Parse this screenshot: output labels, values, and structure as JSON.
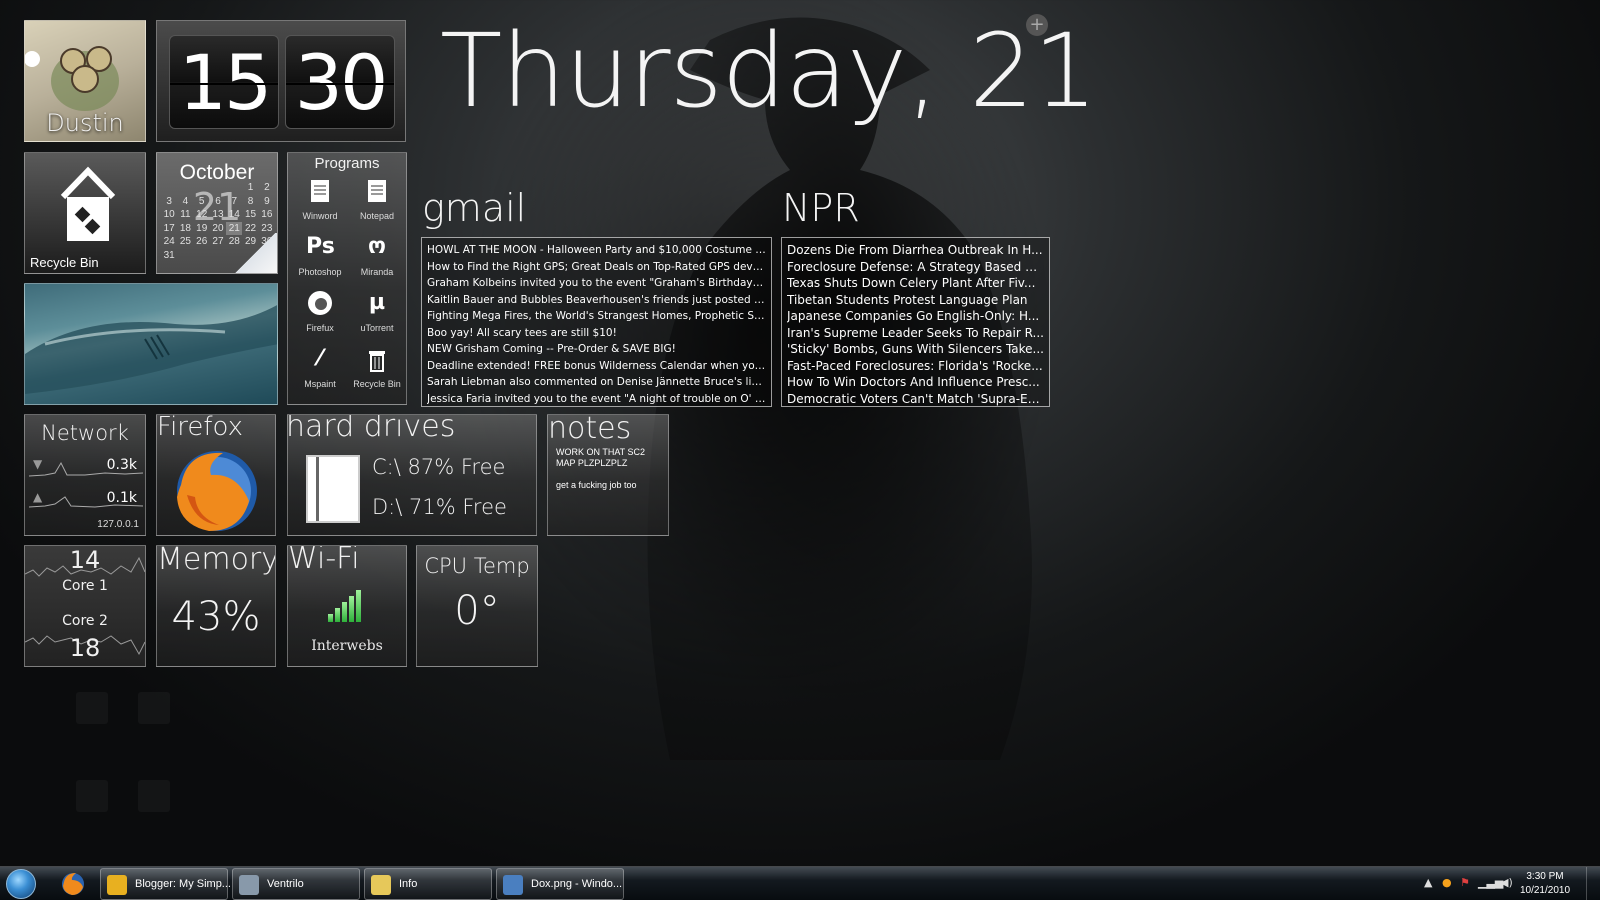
{
  "user": {
    "name": "Dustin"
  },
  "clock": {
    "hour": "15",
    "minute": "30"
  },
  "date_heading": "Thursday, 21",
  "recycle_bin": {
    "label": "Recycle Bin"
  },
  "calendar": {
    "month": "October",
    "day": "21",
    "weekday_row": [
      "S",
      "M",
      "T",
      "W",
      "T",
      "F",
      "S"
    ],
    "days": [
      "",
      "",
      "",
      "",
      "",
      "1",
      "2",
      "3",
      "4",
      "5",
      "6",
      "7",
      "8",
      "9",
      "10",
      "11",
      "12",
      "13",
      "14",
      "15",
      "16",
      "17",
      "18",
      "19",
      "20",
      "21",
      "22",
      "23",
      "24",
      "25",
      "26",
      "27",
      "28",
      "29",
      "30",
      "31"
    ]
  },
  "programs": {
    "title": "Programs",
    "items": [
      {
        "label": "Winword",
        "icon": "word-icon"
      },
      {
        "label": "Notepad",
        "icon": "notepad-icon"
      },
      {
        "label": "Photoshop",
        "icon": "photoshop-icon",
        "glyph": "Ps"
      },
      {
        "label": "Miranda",
        "icon": "miranda-icon",
        "glyph": "ო"
      },
      {
        "label": "Firefux",
        "icon": "firefox-icon"
      },
      {
        "label": "uTorrent",
        "icon": "utorrent-icon",
        "glyph": "µ"
      },
      {
        "label": "Mspaint",
        "icon": "mspaint-icon",
        "glyph": "⁄"
      },
      {
        "label": "Recycle Bin",
        "icon": "trash-icon"
      }
    ]
  },
  "gmail": {
    "title": "gmail",
    "items": [
      "HOWL AT THE MOON - Halloween Party and $10,000 Costume Con...",
      "How to Find the Right GPS; Great Deals on Top-Rated GPS device...",
      "Graham Kolbeins invited you to the event \"Graham's Birthday Pic...",
      "Kaitlin Bauer and Bubbles Beaverhousen's friends just posted in F...",
      "Fighting Mega Fires, the World's Strangest Homes, Prophetic Sci-F...",
      "Boo yay! All scary tees are still $10!",
      "NEW Grisham Coming -- Pre-Order & SAVE BIG!",
      "Deadline extended! FREE bonus Wilderness Calendar when you be...",
      "Sarah Liebman also commented on Denise Jännette Bruce's link.",
      "Jessica Faria invited you to the event \"A night of trouble on O' H..."
    ]
  },
  "npr": {
    "title": "NPR",
    "items": [
      "Dozens Die From Diarrhea Outbreak In H...",
      "Foreclosure Defense: A Strategy Based O...",
      "Texas Shuts Down Celery Plant After Fiv...",
      "Tibetan Students Protest Language Plan",
      "Japanese Companies Go English-Only: H...",
      "Iran's Supreme Leader Seeks To Repair R...",
      "'Sticky' Bombs, Guns With Silencers Take...",
      "Fast-Paced Foreclosures: Florida's 'Rocke...",
      "How To Win Doctors And Influence Presc...",
      "Democratic Voters Can't Match 'Supra-En..."
    ]
  },
  "network": {
    "title": "Network",
    "down": "0.3k",
    "up": "0.1k",
    "ip": "127.0.0.1"
  },
  "firefox_tile": {
    "title": "Firefox"
  },
  "hard_drives": {
    "title": "hard drives",
    "c": "C:\\ 87% Free",
    "d": "D:\\ 71% Free"
  },
  "notes": {
    "title": "notes",
    "line1": "WORK ON THAT SC2",
    "line2": "MAP PLZPLZPLZ",
    "line3": "get a fucking job too"
  },
  "cores": {
    "core1_value": "14",
    "core1_label": "Core 1",
    "core2_label": "Core 2",
    "core2_value": "18"
  },
  "memory": {
    "title": "Memory",
    "value": "43%"
  },
  "wifi": {
    "title": "Wi-Fi",
    "subtitle": "Interwebs",
    "signal_bars": 5
  },
  "cpu_temp": {
    "title": "CPU Temp",
    "value": "0°"
  },
  "taskbar": {
    "buttons": [
      {
        "label": "Blogger: My Simp...",
        "icon": "chrome-icon",
        "color": "#e8b020"
      },
      {
        "label": "Ventrilo",
        "icon": "ventrilo-icon",
        "color": "#8899aa"
      },
      {
        "label": "Info",
        "icon": "folder-icon",
        "color": "#e6c85a"
      },
      {
        "label": "Dox.png - Windo...",
        "icon": "image-viewer-icon",
        "color": "#4a7fc0"
      }
    ],
    "clock_time": "3:30 PM",
    "clock_date": "10/21/2010"
  }
}
